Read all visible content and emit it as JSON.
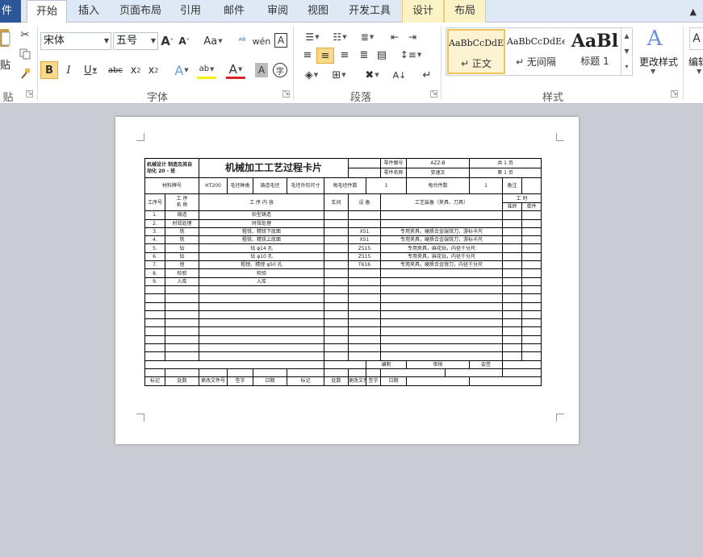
{
  "tabs": [
    {
      "label": "件"
    },
    {
      "label": "开始"
    },
    {
      "label": "插入"
    },
    {
      "label": "页面布局"
    },
    {
      "label": "引用"
    },
    {
      "label": "邮件"
    },
    {
      "label": "审阅"
    },
    {
      "label": "视图"
    },
    {
      "label": "开发工具"
    },
    {
      "label": "设计"
    },
    {
      "label": "布局"
    }
  ],
  "ribbon": {
    "groups": {
      "clipboard": "贴板",
      "font": "字体",
      "paragraph": "段落",
      "styles": "样式"
    },
    "paste_label": "贴",
    "font_name": "宋体",
    "font_size": "五号",
    "styles": [
      {
        "sample": "AaBbCcDdEe",
        "name": "↵ 正文"
      },
      {
        "sample": "AaBbCcDdEe",
        "name": "↵ 无间隔"
      },
      {
        "sample": "AaBl",
        "name": "标题 1"
      }
    ],
    "change_styles": "更改样式",
    "edit_label": "编辑"
  },
  "card": {
    "school": "机械设计 制造及其自",
    "class": "动化 20    -    班",
    "title": "机械加工工艺过程卡片",
    "part_no_label": "零件图号",
    "part_no": "AZZ-B",
    "part_name_label": "零件名称",
    "part_name": "变速叉",
    "total_pages": "共 1 页",
    "page_no": "第 1 页",
    "material_label": "材料牌号",
    "material": "HT200",
    "blank_type_label": "毛坯种类",
    "blank_type": "铸造毛坯",
    "blank_size_label": "毛坯外形尺寸",
    "pieces_label": "每毛坯件数",
    "pieces": "1",
    "per_unit_label": "每台件数",
    "per_unit": "1",
    "notes_label": "备注",
    "col_headers": {
      "op_no": "工序号",
      "op_name_1": "工 序",
      "op_name_2": "名 称",
      "content": "工 序 内 容",
      "workshop": "车间",
      "equipment": "设 备",
      "tooling": "工艺装备（夹具、刀具）",
      "time": "工 时",
      "prep": "准终",
      "unit": "单件"
    },
    "rows": [
      {
        "no": "1.",
        "name": "铸造",
        "content": "砂型铸造",
        "eq": "",
        "tool": ""
      },
      {
        "no": "2.",
        "name": "时效处理",
        "content": "时效处理",
        "eq": "",
        "tool": ""
      },
      {
        "no": "3.",
        "name": "铣",
        "content": "粗铣、精铣下底面",
        "eq": "X51",
        "tool": "专用夹具，硬质合金端铣刀，游标卡尺"
      },
      {
        "no": "4.",
        "name": "铣",
        "content": "粗铣、精铣上底面",
        "eq": "X51",
        "tool": "专用夹具，硬质合金端铣刀，游标卡尺"
      },
      {
        "no": "5.",
        "name": "钻",
        "content": "钻 φ14 孔",
        "eq": "Z515",
        "tool": "专用夹具，麻花钻，内径千分尺"
      },
      {
        "no": "6.",
        "name": "钻",
        "content": "钻 φ10 孔",
        "eq": "Z515",
        "tool": "专用夹具，麻花钻，内径千分尺"
      },
      {
        "no": "7.",
        "name": "镗",
        "content": "粗镗、精镗 φ50 孔",
        "eq": "T616",
        "tool": "专用夹具，硬质合金镗刀，内径千分尺"
      },
      {
        "no": "8.",
        "name": "检验",
        "content": "检验",
        "eq": "",
        "tool": ""
      },
      {
        "no": "9.",
        "name": "入库",
        "content": "入库",
        "eq": "",
        "tool": ""
      }
    ],
    "footer": {
      "design": "编制",
      "review": "审核",
      "countersign": "会签",
      "mark": "标记",
      "count": "处数",
      "change_doc": "更改文件号",
      "sign": "签字",
      "date": "日期"
    }
  }
}
